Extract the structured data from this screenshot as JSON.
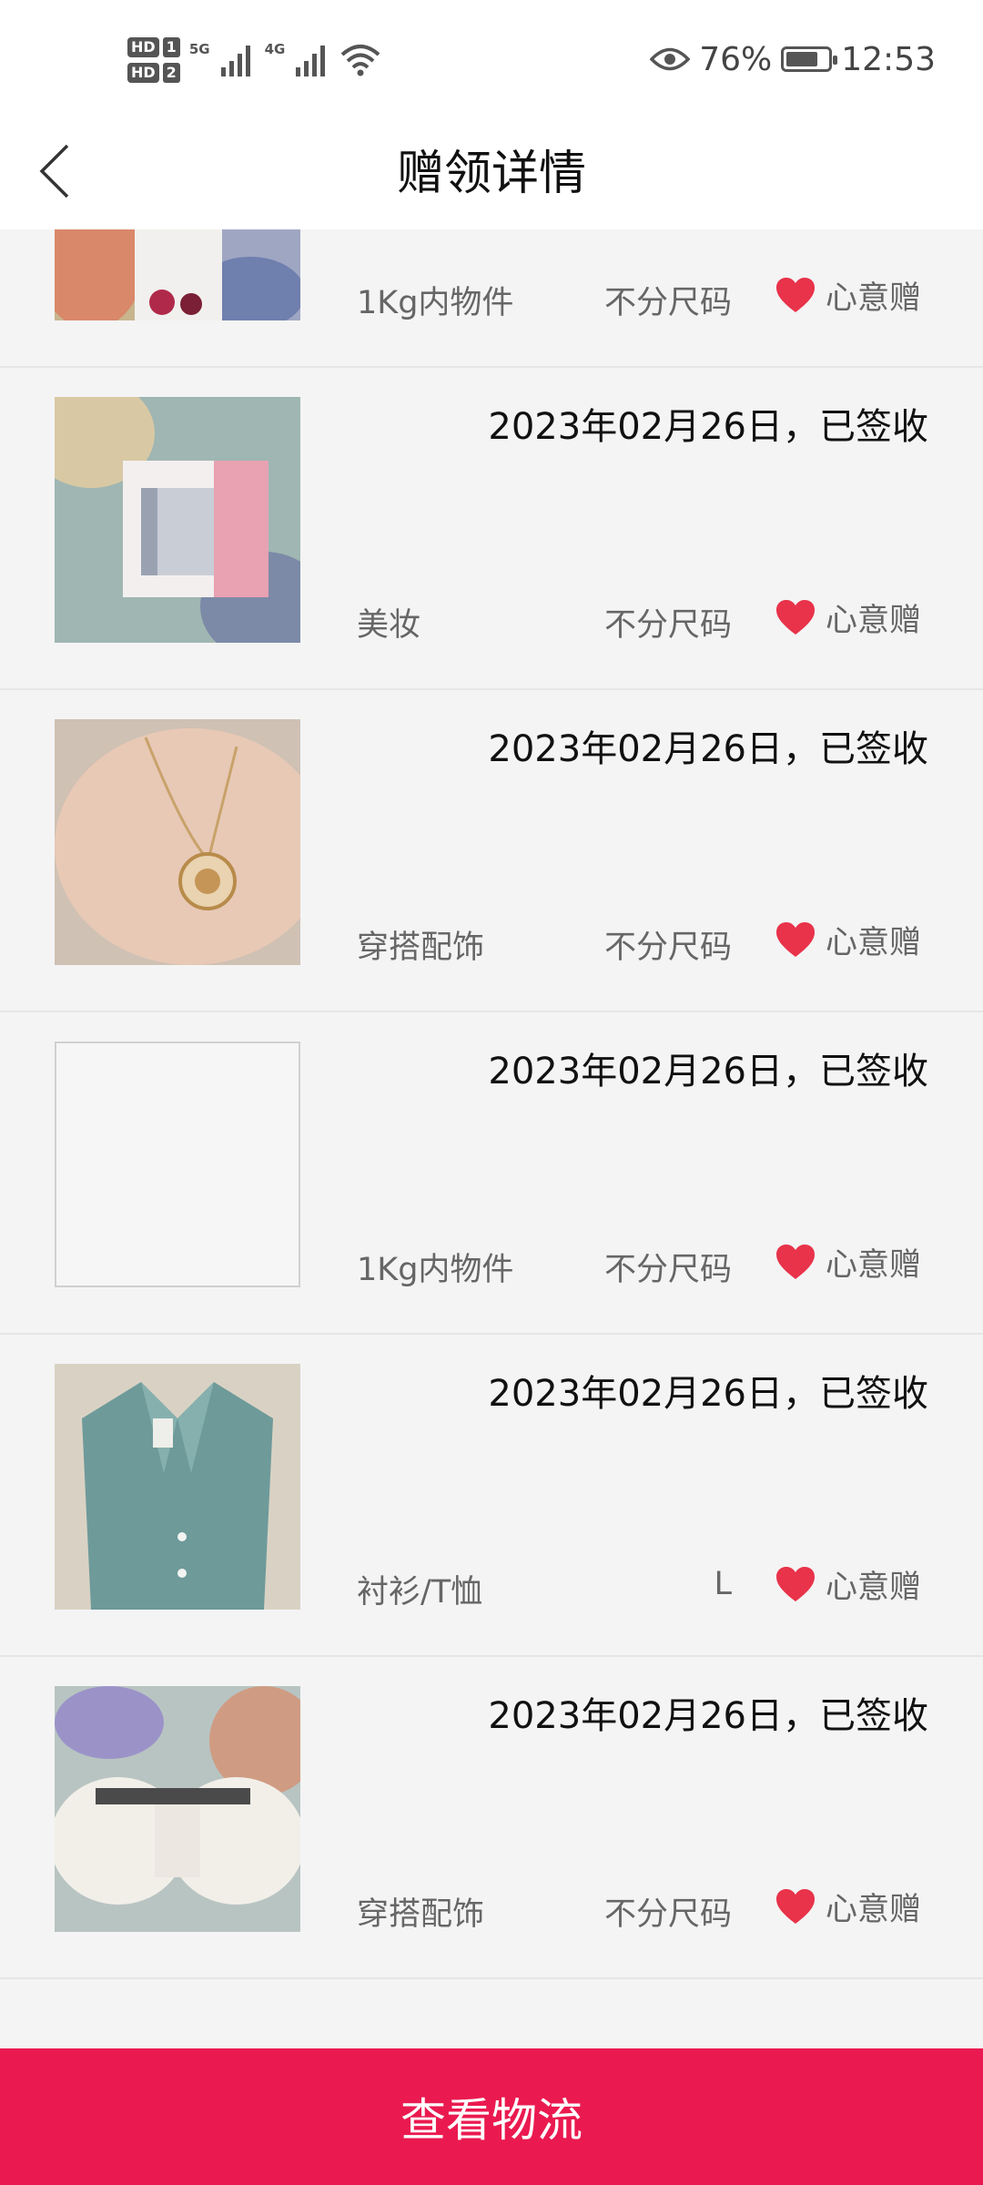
{
  "status_bar": {
    "hd1": "HD",
    "sim1": "1",
    "hd2": "HD",
    "sim2": "2",
    "net1": "5G",
    "net2": "4G",
    "battery_pct": "76%",
    "battery_level": 0.76,
    "time": "12:53"
  },
  "header": {
    "title": "赠领详情"
  },
  "items": [
    {
      "date": "",
      "category": "1Kg内物件",
      "size": "不分尺码",
      "gift": "心意赠",
      "thumb": "soda-bottle"
    },
    {
      "date": "2023年02月26日，已签收",
      "category": "美妆",
      "size": "不分尺码",
      "gift": "心意赠",
      "thumb": "olay-cream"
    },
    {
      "date": "2023年02月26日，已签收",
      "category": "穿搭配饰",
      "size": "不分尺码",
      "gift": "心意赠",
      "thumb": "pendant-necklace"
    },
    {
      "date": "2023年02月26日，已签收",
      "category": "1Kg内物件",
      "size": "不分尺码",
      "gift": "心意赠",
      "thumb": "blank"
    },
    {
      "date": "2023年02月26日，已签收",
      "category": "衬衫/T恤",
      "size": "L",
      "gift": "心意赠",
      "thumb": "blue-shirt"
    },
    {
      "date": "2023年02月26日，已签收",
      "category": "穿搭配饰",
      "size": "不分尺码",
      "gift": "心意赠",
      "thumb": "bow-hairclip"
    }
  ],
  "footer": {
    "button_label": "查看物流"
  },
  "colors": {
    "accent": "#ea1a50",
    "heart": "#e8334a",
    "background": "#f4f4f4"
  }
}
